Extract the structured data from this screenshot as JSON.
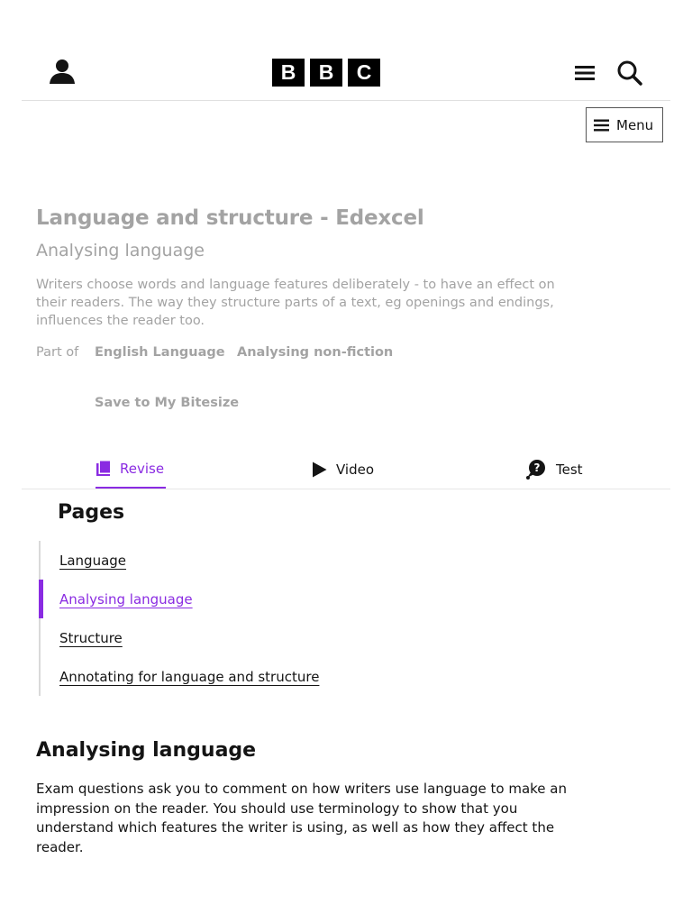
{
  "header": {
    "logo_letters": [
      "B",
      "B",
      "C"
    ],
    "account_icon": "user-icon",
    "menu_icon": "hamburger-icon",
    "search_icon": "search-icon"
  },
  "subnav": {
    "menu_label": "Menu"
  },
  "hero": {
    "title": "Language and structure - Edexcel",
    "subtitle": "Analysing language",
    "description": "Writers choose words and language features deliberately - to have an effect on their readers. The way they structure parts of a text, eg openings and endings, influences the reader too.",
    "part_of_label": "Part of",
    "part_of_links": [
      "English Language",
      "Analysing non-fiction"
    ],
    "save_label": "Save to My Bitesize"
  },
  "tabs": [
    {
      "label": "Revise",
      "icon": "book-icon",
      "active": true
    },
    {
      "label": "Video",
      "icon": "play-icon",
      "active": false
    },
    {
      "label": "Test",
      "icon": "question-bubble-icon",
      "active": false
    }
  ],
  "pages": {
    "heading": "Pages",
    "items": [
      {
        "label": "Language",
        "current": false
      },
      {
        "label": "Analysing language",
        "current": true
      },
      {
        "label": "Structure",
        "current": false
      },
      {
        "label": "Annotating for language and structure",
        "current": false
      }
    ]
  },
  "article": {
    "heading": "Analysing language",
    "body": "Exam questions ask you to comment on how writers use language to make an impression on the reader. You should use terminology to show that you understand which features the writer is using, as well as how they affect the reader."
  },
  "colors": {
    "accent": "#8a2be2",
    "muted_text": "#a3a3a3",
    "text": "#141414"
  }
}
